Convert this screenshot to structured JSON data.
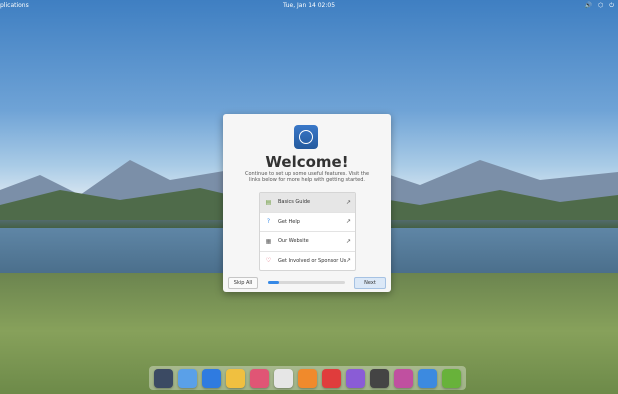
{
  "topbar": {
    "applications_label": "plications",
    "clock": "Tue, Jan 14   02:05",
    "tray_icons": [
      "volume-icon",
      "network-icon",
      "power-icon"
    ]
  },
  "welcome": {
    "title": "Welcome!",
    "description": "Continue to set up some useful features. Visit the links below for more help with getting started.",
    "links": [
      {
        "label": "Basics Guide",
        "icon": "document-icon",
        "external": "external-link-icon"
      },
      {
        "label": "Get Help",
        "icon": "help-icon",
        "external": "external-link-icon"
      },
      {
        "label": "Our Website",
        "icon": "website-icon",
        "external": "external-link-icon"
      },
      {
        "label": "Get Involved or Sponsor Us",
        "icon": "heart-icon",
        "external": "external-link-icon"
      }
    ],
    "skip_label": "Skip All",
    "next_label": "Next",
    "progress_fraction": 0.14
  },
  "dock": {
    "items": [
      "multitasking-view-icon",
      "files-icon",
      "web-browser-icon",
      "mail-icon",
      "tasks-icon",
      "calendar-icon",
      "music-icon",
      "videos-icon",
      "photos-icon",
      "system-settings-icon",
      "appcenter-icon",
      "web-installer-icon",
      "checkmark-icon"
    ],
    "colors": [
      "#3b4a63",
      "#5aa0e8",
      "#2f7be0",
      "#f0c040",
      "#e05575",
      "#e6e6e6",
      "#f08a2c",
      "#e03c3c",
      "#8a5cd6",
      "#444444",
      "#c050a0",
      "#3c8ae0",
      "#68b23a"
    ]
  }
}
